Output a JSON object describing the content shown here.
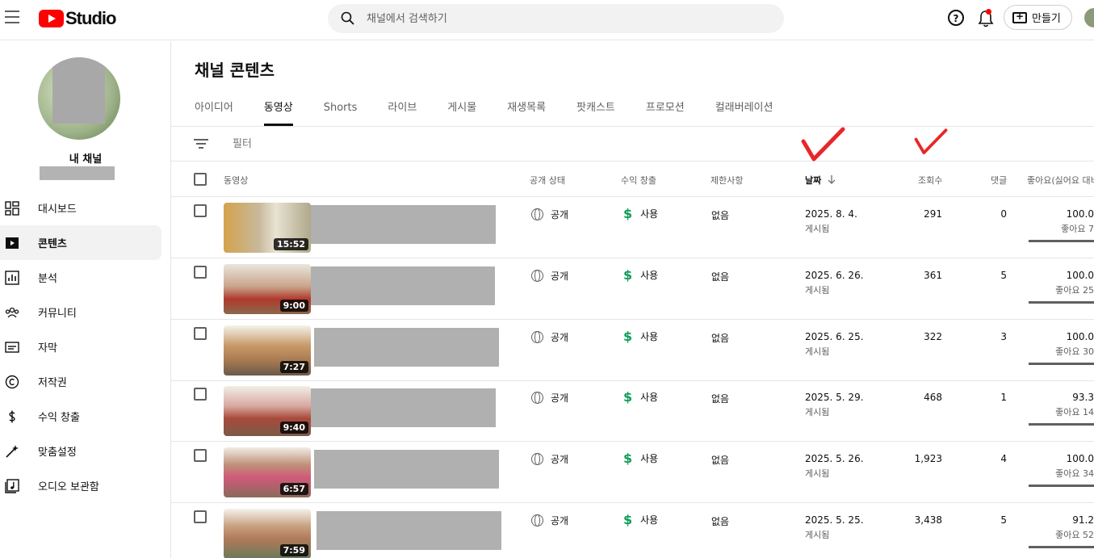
{
  "header": {
    "logo_text": "Studio",
    "search_placeholder": "채널에서 검색하기",
    "help_label": "?",
    "create_label": "만들기"
  },
  "sidebar": {
    "channel_name": "내 채널",
    "items": [
      {
        "label": "대시보드",
        "icon": "dashboard-icon"
      },
      {
        "label": "콘텐츠",
        "icon": "content-icon"
      },
      {
        "label": "분석",
        "icon": "analytics-icon"
      },
      {
        "label": "커뮤니티",
        "icon": "community-icon"
      },
      {
        "label": "자막",
        "icon": "subtitles-icon"
      },
      {
        "label": "저작권",
        "icon": "copyright-icon"
      },
      {
        "label": "수익 창출",
        "icon": "monetization-icon"
      },
      {
        "label": "맞춤설정",
        "icon": "customization-icon"
      },
      {
        "label": "오디오 보관함",
        "icon": "audio-library-icon"
      }
    ]
  },
  "main": {
    "title": "채널 콘텐츠",
    "tabs": [
      "아이디어",
      "동영상",
      "Shorts",
      "라이브",
      "게시물",
      "재생목록",
      "팟캐스트",
      "프로모션",
      "컬래버레이션"
    ],
    "active_tab": "동영상",
    "filter_placeholder": "필터",
    "columns": {
      "video": "동영상",
      "visibility": "공개 상태",
      "monetization": "수익 창출",
      "restrictions": "제한사항",
      "date": "날짜",
      "views": "조회수",
      "comments": "댓글",
      "likes": "좋아요(싫어요 대비"
    },
    "rows": [
      {
        "duration": "15:52",
        "visibility": "공개",
        "monetization": "사용",
        "restrictions": "없음",
        "date": "2025. 8. 4.",
        "date_status": "게시됨",
        "views": "291",
        "comments": "0",
        "likes": "100.0",
        "likes_sub": "좋아요 7"
      },
      {
        "duration": "9:00",
        "visibility": "공개",
        "monetization": "사용",
        "restrictions": "없음",
        "date": "2025. 6. 26.",
        "date_status": "게시됨",
        "views": "361",
        "comments": "5",
        "likes": "100.0",
        "likes_sub": "좋아요 25"
      },
      {
        "duration": "7:27",
        "visibility": "공개",
        "monetization": "사용",
        "restrictions": "없음",
        "date": "2025. 6. 25.",
        "date_status": "게시됨",
        "views": "322",
        "comments": "3",
        "likes": "100.0",
        "likes_sub": "좋아요 30"
      },
      {
        "duration": "9:40",
        "visibility": "공개",
        "monetization": "사용",
        "restrictions": "없음",
        "date": "2025. 5. 29.",
        "date_status": "게시됨",
        "views": "468",
        "comments": "1",
        "likes": "93.3",
        "likes_sub": "좋아요 14"
      },
      {
        "duration": "6:57",
        "visibility": "공개",
        "monetization": "사용",
        "restrictions": "없음",
        "date": "2025. 5. 26.",
        "date_status": "게시됨",
        "views": "1,923",
        "comments": "4",
        "likes": "100.0",
        "likes_sub": "좋아요 34"
      },
      {
        "duration": "7:59",
        "visibility": "공개",
        "monetization": "사용",
        "restrictions": "없음",
        "date": "2025. 5. 25.",
        "date_status": "게시됨",
        "views": "3,438",
        "comments": "5",
        "likes": "91.2",
        "likes_sub": "좋아요 52"
      }
    ]
  },
  "colors": {
    "brand_red": "#ff0000",
    "monetization_green": "#0f9d58",
    "annotation_red": "#e8262a"
  }
}
